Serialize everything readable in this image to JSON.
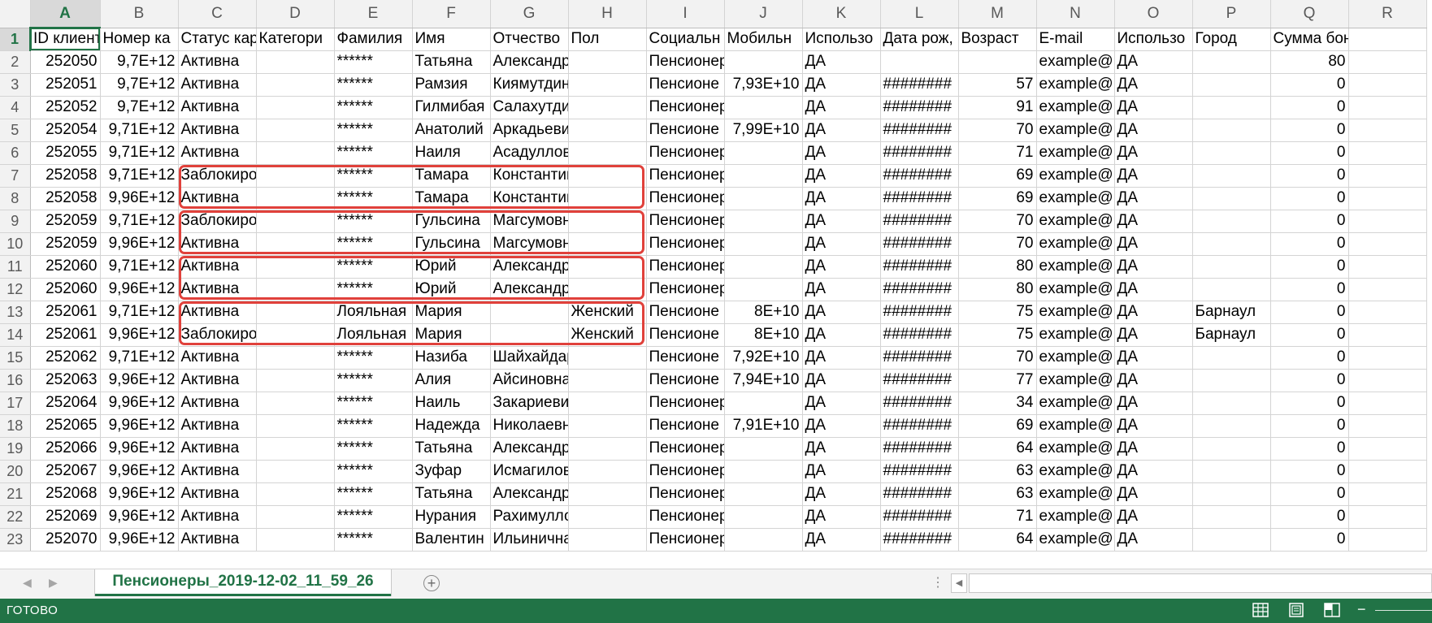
{
  "columns": [
    "A",
    "B",
    "C",
    "D",
    "E",
    "F",
    "G",
    "H",
    "I",
    "J",
    "K",
    "L",
    "M",
    "N",
    "O",
    "P",
    "Q",
    "R"
  ],
  "selected_column": "A",
  "selected_row": 1,
  "rows": [
    {
      "n": "1",
      "cells": [
        "ID клиент",
        "Номер ка",
        "Статус кар",
        "Категори",
        "Фамилия",
        "Имя",
        "Отчество",
        "Пол",
        "Социальн",
        "Мобильн",
        "Использо",
        "Дата рож,",
        "Возраст",
        "E-mail",
        "Использо",
        "Город",
        "Сумма бонусов",
        ""
      ]
    },
    {
      "n": "2",
      "cells": [
        "252050",
        "9,7E+12",
        "Активна",
        "",
        "******",
        "Татьяна",
        "Александровна",
        "",
        "Пенсионер",
        "",
        "ДА",
        "",
        "",
        "example@",
        "ДА",
        "",
        "80",
        ""
      ]
    },
    {
      "n": "3",
      "cells": [
        "252051",
        "9,7E+12",
        "Активна",
        "",
        "******",
        "Рамзия",
        "Киямутдиновна",
        "",
        "Пенсионе",
        "7,93E+10",
        "ДА",
        "########",
        "57",
        "example@",
        "ДА",
        "",
        "0",
        ""
      ]
    },
    {
      "n": "4",
      "cells": [
        "252052",
        "9,7E+12",
        "Активна",
        "",
        "******",
        "Гилмибая",
        "Салахутдиновна",
        "",
        "Пенсионер",
        "",
        "ДА",
        "########",
        "91",
        "example@",
        "ДА",
        "",
        "0",
        ""
      ]
    },
    {
      "n": "5",
      "cells": [
        "252054",
        "9,71E+12",
        "Активна",
        "",
        "******",
        "Анатолий",
        "Аркадьевич",
        "",
        "Пенсионе",
        "7,99E+10",
        "ДА",
        "########",
        "70",
        "example@",
        "ДА",
        "",
        "0",
        ""
      ]
    },
    {
      "n": "6",
      "cells": [
        "252055",
        "9,71E+12",
        "Активна",
        "",
        "******",
        "Наиля",
        "Асадулловна",
        "",
        "Пенсионер",
        "",
        "ДА",
        "########",
        "71",
        "example@",
        "ДА",
        "",
        "0",
        ""
      ]
    },
    {
      "n": "7",
      "cells": [
        "252058",
        "9,71E+12",
        "Заблокирована",
        "",
        "******",
        "Тамара",
        "Константиновна",
        "",
        "Пенсионер",
        "",
        "ДА",
        "########",
        "69",
        "example@",
        "ДА",
        "",
        "0",
        ""
      ]
    },
    {
      "n": "8",
      "cells": [
        "252058",
        "9,96E+12",
        "Активна",
        "",
        "******",
        "Тамара",
        "Константиновна",
        "",
        "Пенсионер",
        "",
        "ДА",
        "########",
        "69",
        "example@",
        "ДА",
        "",
        "0",
        ""
      ]
    },
    {
      "n": "9",
      "cells": [
        "252059",
        "9,71E+12",
        "Заблокирована",
        "",
        "******",
        "Гульсина",
        "Магсумовна",
        "",
        "Пенсионер",
        "",
        "ДА",
        "########",
        "70",
        "example@",
        "ДА",
        "",
        "0",
        ""
      ]
    },
    {
      "n": "10",
      "cells": [
        "252059",
        "9,96E+12",
        "Активна",
        "",
        "******",
        "Гульсина",
        "Магсумовна",
        "",
        "Пенсионер",
        "",
        "ДА",
        "########",
        "70",
        "example@",
        "ДА",
        "",
        "0",
        ""
      ]
    },
    {
      "n": "11",
      "cells": [
        "252060",
        "9,71E+12",
        "Активна",
        "",
        "******",
        "Юрий",
        "Александрович",
        "",
        "Пенсионер",
        "",
        "ДА",
        "########",
        "80",
        "example@",
        "ДА",
        "",
        "0",
        ""
      ]
    },
    {
      "n": "12",
      "cells": [
        "252060",
        "9,96E+12",
        "Активна",
        "",
        "******",
        "Юрий",
        "Александрович",
        "",
        "Пенсионер",
        "",
        "ДА",
        "########",
        "80",
        "example@",
        "ДА",
        "",
        "0",
        ""
      ]
    },
    {
      "n": "13",
      "cells": [
        "252061",
        "9,71E+12",
        "Активна",
        "",
        "Лояльная",
        "Мария",
        "",
        "Женский",
        "Пенсионе",
        "8E+10",
        "ДА",
        "########",
        "75",
        "example@",
        "ДА",
        "Барнаул",
        "0",
        ""
      ]
    },
    {
      "n": "14",
      "cells": [
        "252061",
        "9,96E+12",
        "Заблокирована",
        "",
        "Лояльная",
        "Мария",
        "",
        "Женский",
        "Пенсионе",
        "8E+10",
        "ДА",
        "########",
        "75",
        "example@",
        "ДА",
        "Барнаул",
        "0",
        ""
      ]
    },
    {
      "n": "15",
      "cells": [
        "252062",
        "9,71E+12",
        "Активна",
        "",
        "******",
        "Назиба",
        "Шайхайдаровна",
        "",
        "Пенсионе",
        "7,92E+10",
        "ДА",
        "########",
        "70",
        "example@",
        "ДА",
        "",
        "0",
        ""
      ]
    },
    {
      "n": "16",
      "cells": [
        "252063",
        "9,96E+12",
        "Активна",
        "",
        "******",
        "Алия",
        "Айсиновна",
        "",
        "Пенсионе",
        "7,94E+10",
        "ДА",
        "########",
        "77",
        "example@",
        "ДА",
        "",
        "0",
        ""
      ]
    },
    {
      "n": "17",
      "cells": [
        "252064",
        "9,96E+12",
        "Активна",
        "",
        "******",
        "Наиль",
        "Закариевич",
        "",
        "Пенсионер",
        "",
        "ДА",
        "########",
        "34",
        "example@",
        "ДА",
        "",
        "0",
        ""
      ]
    },
    {
      "n": "18",
      "cells": [
        "252065",
        "9,96E+12",
        "Активна",
        "",
        "******",
        "Надежда",
        "Николаевна",
        "",
        "Пенсионе",
        "7,91E+10",
        "ДА",
        "########",
        "69",
        "example@",
        "ДА",
        "",
        "0",
        ""
      ]
    },
    {
      "n": "19",
      "cells": [
        "252066",
        "9,96E+12",
        "Активна",
        "",
        "******",
        "Татьяна",
        "Александровна",
        "",
        "Пенсионер",
        "",
        "ДА",
        "########",
        "64",
        "example@",
        "ДА",
        "",
        "0",
        ""
      ]
    },
    {
      "n": "20",
      "cells": [
        "252067",
        "9,96E+12",
        "Активна",
        "",
        "******",
        "Зуфар",
        "Исмагилович",
        "",
        "Пенсионер",
        "",
        "ДА",
        "########",
        "63",
        "example@",
        "ДА",
        "",
        "0",
        ""
      ]
    },
    {
      "n": "21",
      "cells": [
        "252068",
        "9,96E+12",
        "Активна",
        "",
        "******",
        "Татьяна",
        "Александровна",
        "",
        "Пенсионер",
        "",
        "ДА",
        "########",
        "63",
        "example@",
        "ДА",
        "",
        "0",
        ""
      ]
    },
    {
      "n": "22",
      "cells": [
        "252069",
        "9,96E+12",
        "Активна",
        "",
        "******",
        "Нурания",
        "Рахимулловна",
        "",
        "Пенсионер",
        "",
        "ДА",
        "########",
        "71",
        "example@",
        "ДА",
        "",
        "0",
        ""
      ]
    },
    {
      "n": "23",
      "cells": [
        "252070",
        "9,96E+12",
        "Активна",
        "",
        "******",
        "Валентин",
        "Ильинична",
        "",
        "Пенсионер",
        "",
        "ДА",
        "########",
        "64",
        "example@",
        "ДА",
        "",
        "0",
        ""
      ]
    }
  ],
  "sheet_tab": {
    "label": "Пенсионеры_2019-12-02_11_59_26"
  },
  "add_sheet_label": "+",
  "tab_nav": {
    "prev": "◀",
    "next": "▶",
    "dots": "⋮",
    "scroll_left": "◀"
  },
  "status_bar": {
    "text": "ГОТОВО",
    "zoom_out": "−"
  },
  "colors": {
    "excel_green": "#217346",
    "highlight_red": "#e0413b",
    "header_gray": "#f2f2f2"
  },
  "icons": [
    "normal-view-icon",
    "page-layout-view-icon",
    "page-break-view-icon"
  ]
}
